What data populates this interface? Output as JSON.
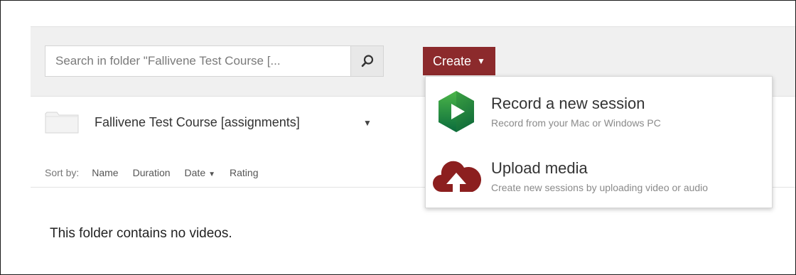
{
  "search": {
    "placeholder": "Search in folder \"Fallivene Test Course [...",
    "icon": "search-icon"
  },
  "create": {
    "label": "Create",
    "caret": "▼",
    "color": "#8c2a2c"
  },
  "dropdown": {
    "items": [
      {
        "title": "Record a new session",
        "subtitle": "Record from your Mac or Windows PC",
        "icon": "panopto-record-icon"
      },
      {
        "title": "Upload media",
        "subtitle": "Create new sessions by uploading video or audio",
        "icon": "cloud-upload-icon"
      }
    ]
  },
  "folder": {
    "name": "Fallivene Test Course [assignments]",
    "icon": "folder-icon"
  },
  "sort": {
    "label": "Sort by:",
    "options": [
      "Name",
      "Duration",
      "Date",
      "Rating"
    ],
    "active": "Date",
    "active_indicator": "▼"
  },
  "empty_message": "This folder contains no videos."
}
